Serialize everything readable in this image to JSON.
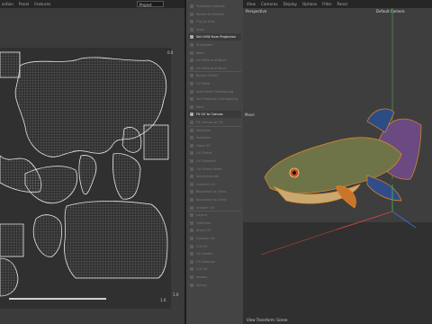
{
  "uv_editor": {
    "menu": [
      "ection",
      "Panel",
      "Features"
    ],
    "project_select": "Project",
    "coord_top": "0.0",
    "coord_bottom": "1.0",
    "coord_right": "1.0"
  },
  "command_panel": {
    "items": [
      {
        "label": "Transform Islands",
        "active": false
      },
      {
        "label": "Rotate to Vertical",
        "active": false
      },
      {
        "label": "Flip by Axis",
        "active": false
      },
      {
        "label": "Align",
        "active": false
      },
      {
        "label": "Set UVW from Projection",
        "active": true
      },
      {
        "label": "Straighten",
        "active": false
      },
      {
        "label": "Weld",
        "active": false
      },
      {
        "label": "UV Weld and Move",
        "active": false
      },
      {
        "label": "UV Weld and Move",
        "active": false
      },
      {
        "label": "Border Select",
        "active": false
      },
      {
        "label": "UV Weld",
        "active": false
      },
      {
        "label": "Spot Weld Overlapping",
        "active": false
      },
      {
        "label": "Sort Relative Overlapping",
        "active": false
      },
      {
        "label": "Pack",
        "active": false
      },
      {
        "label": "Fit UV to Canvas",
        "active": true
      },
      {
        "label": "Fit Canvas to UV",
        "active": false
      },
      {
        "label": "Selection",
        "active": false
      },
      {
        "label": "Selection",
        "active": false
      },
      {
        "label": "Grow UV",
        "active": false
      },
      {
        "label": "UV Shrink",
        "active": false
      },
      {
        "label": "UV Deselect",
        "active": false
      },
      {
        "label": "UV Select Seam",
        "active": false
      },
      {
        "label": "Select Islands",
        "active": false
      },
      {
        "label": "Connect UV",
        "active": false
      },
      {
        "label": "Boundary to Ortho",
        "active": false
      },
      {
        "label": "Boundary to Circle",
        "active": false
      },
      {
        "label": "Smooth UV",
        "active": false
      },
      {
        "label": "Layout",
        "active": false
      },
      {
        "label": "Optimize",
        "active": false
      },
      {
        "label": "Stack UV",
        "active": false
      },
      {
        "label": "Unstack UV",
        "active": false
      },
      {
        "label": "Cut UV",
        "active": false
      },
      {
        "label": "UV Seams",
        "active": false
      },
      {
        "label": "UV Remove",
        "active": false
      },
      {
        "label": "Cut UV",
        "active": false
      },
      {
        "label": "Seams",
        "active": false
      },
      {
        "label": "Spring",
        "active": false
      }
    ]
  },
  "perspective": {
    "menu": [
      "View",
      "Cameras",
      "Display",
      "Options",
      "Filter",
      "Panel"
    ],
    "view_name": "Perspective",
    "camera_name": "Default Camera",
    "mode_label": "Move",
    "footer": "View Transform: Scene"
  },
  "colors": {
    "accent_orange": "#e08a2a",
    "axis_red": "#d9483b",
    "axis_green": "#3bb548",
    "axis_blue": "#3a6fd8"
  }
}
